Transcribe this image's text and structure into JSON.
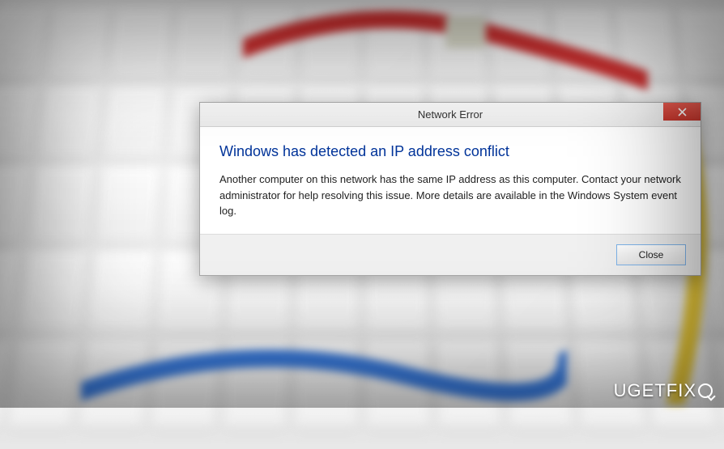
{
  "dialog": {
    "title": "Network Error",
    "heading": "Windows has detected an IP address conflict",
    "body": "Another computer on this network has the same IP address as this computer. Contact your network administrator for help resolving this issue. More details are available in the Windows System event log.",
    "close_button": "Close"
  },
  "watermark": "UGETFIX"
}
